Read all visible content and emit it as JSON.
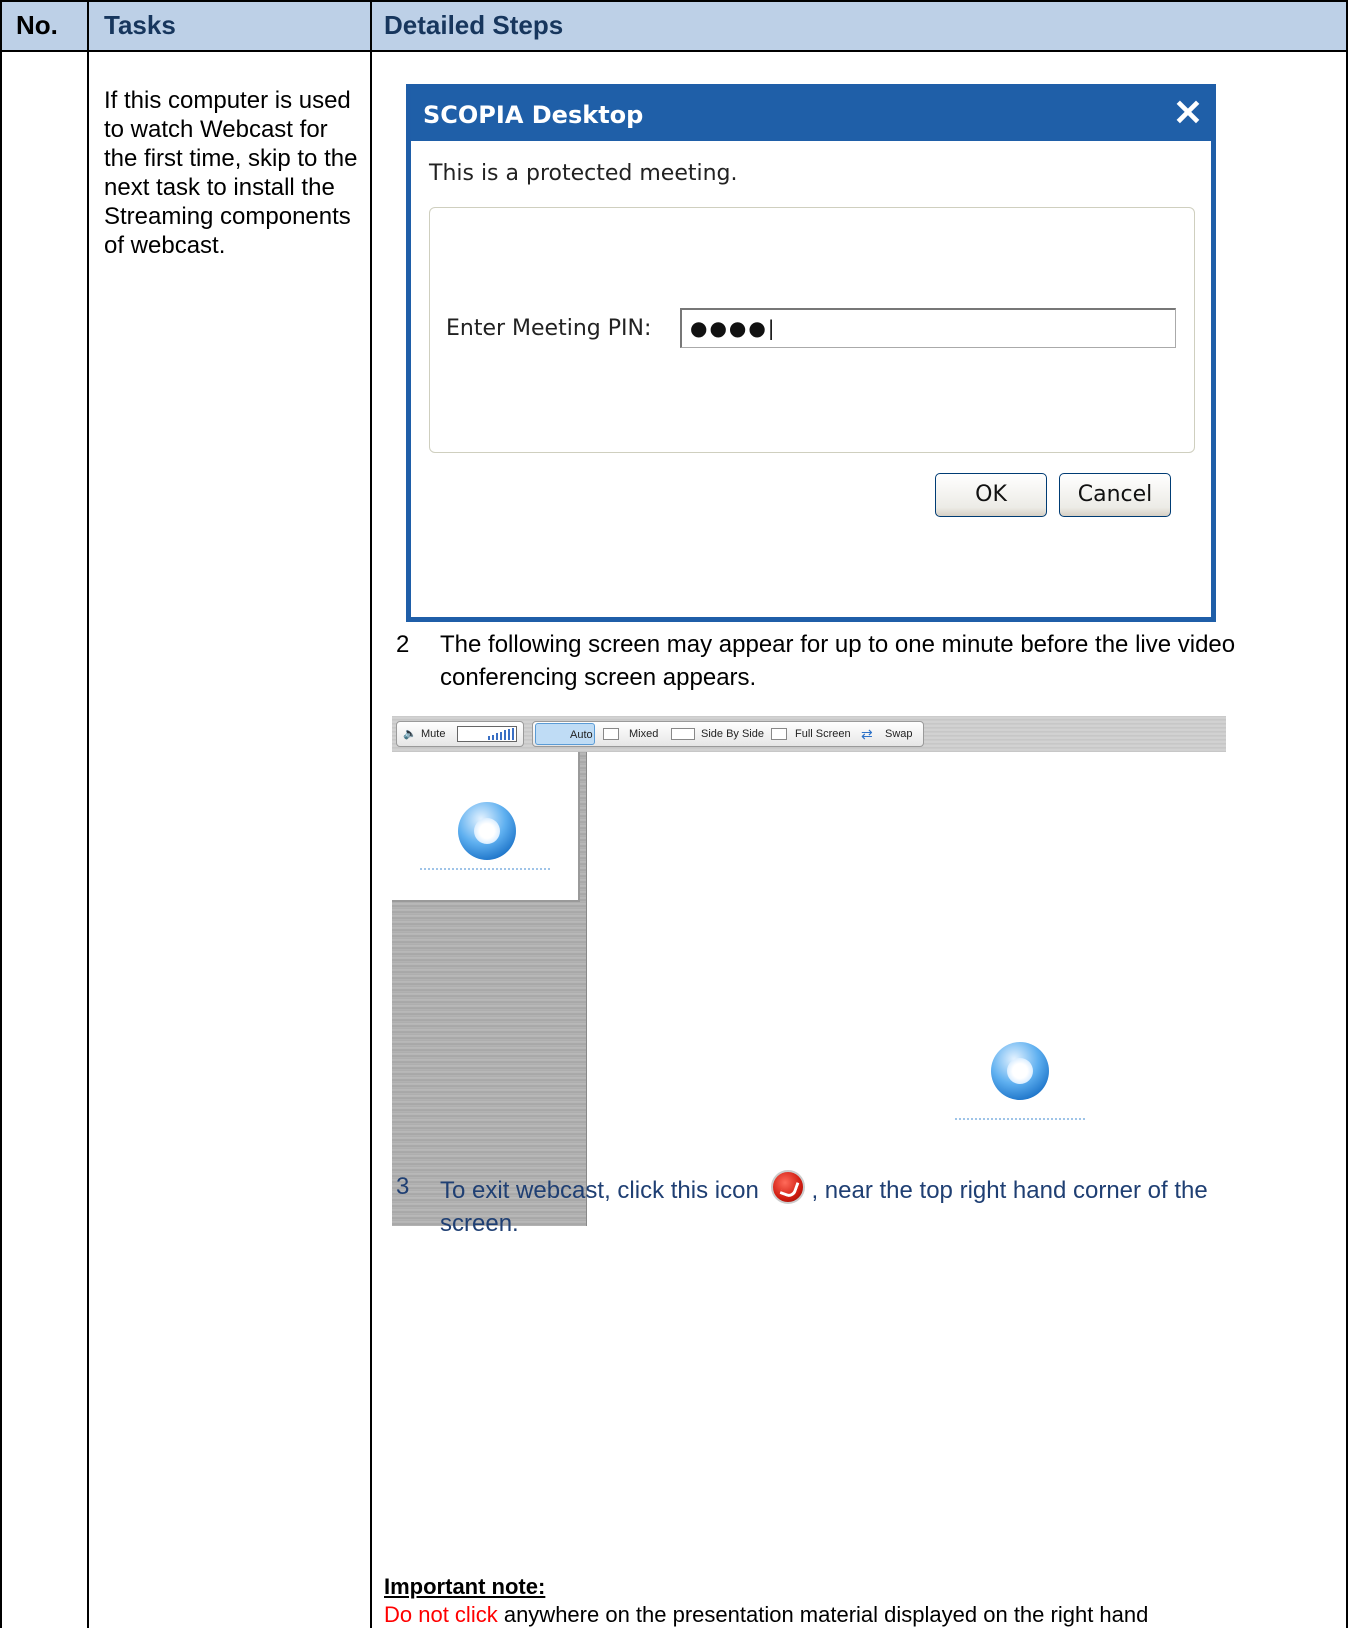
{
  "table": {
    "headers": {
      "no": "No.",
      "tasks": "Tasks",
      "steps": "Detailed Steps"
    },
    "task_text": "If this computer is used to watch Webcast for the first time, skip to the next task to install the Streaming components of webcast."
  },
  "dialog": {
    "title": "SCOPIA Desktop",
    "close_glyph": "✕",
    "message": "This is a protected meeting.",
    "pin_label": "Enter Meeting PIN:",
    "pin_value": "●●●●|",
    "ok_label": "OK",
    "cancel_label": "Cancel"
  },
  "steps": [
    {
      "num": "2",
      "text": "The following screen may appear for up to one minute before the live video conferencing screen appears."
    },
    {
      "num": "3",
      "text_before": "To exit webcast, click this icon",
      "text_after": ", near the top right hand corner of the screen."
    }
  ],
  "webcast_toolbar": {
    "mute": "Mute",
    "auto": "Auto",
    "mixed": "Mixed",
    "side_by_side": "Side By Side",
    "full_screen": "Full Screen",
    "swap": "Swap"
  },
  "important_note": {
    "heading": "Important note:",
    "red_text": "Do not click",
    "rest_text": " anywhere on the presentation material displayed on the right hand"
  },
  "colors": {
    "header_bg": "#bdd0e7",
    "dialog_title_bar": "#1f5fa8",
    "step3_text": "#1f3f73",
    "warning_red": "#ff0000"
  },
  "icons": [
    "close-icon",
    "speaker-icon",
    "swap-icon",
    "quicktime-icon",
    "exit-webcast-icon"
  ]
}
